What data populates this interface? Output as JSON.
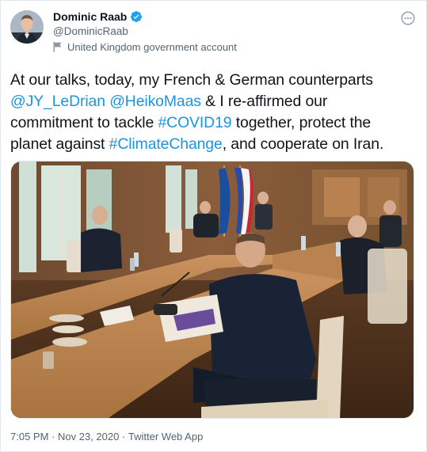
{
  "author": {
    "display_name": "Dominic Raab",
    "handle": "@DominicRaab",
    "label": "United Kingdom government account",
    "verified_icon": "verified-badge-icon",
    "label_icon": "flag-icon"
  },
  "tweet": {
    "lines": [
      [
        {
          "t": "At our talks, today, my French & German counterparts",
          "link": false
        }
      ],
      [
        {
          "t": "@JY_LeDrian",
          "link": true
        },
        {
          "t": " ",
          "link": false
        },
        {
          "t": "@HeikoMaas",
          "link": true
        },
        {
          "t": " & I re-affirmed our",
          "link": false
        }
      ],
      [
        {
          "t": "commitment to tackle ",
          "link": false
        },
        {
          "t": "#COVID19",
          "link": true
        },
        {
          "t": " together, protect the",
          "link": false
        }
      ],
      [
        {
          "t": "planet against ",
          "link": false
        },
        {
          "t": "#ClimateChange",
          "link": true
        },
        {
          "t": ", and cooperate on Iran.",
          "link": false
        }
      ]
    ],
    "media_placeholder": "Raab"
  },
  "meta": {
    "time": "7:05 PM",
    "separator1": " · ",
    "date": "Nov 23, 2020",
    "separator2": " · ",
    "source": "Twitter Web App"
  },
  "colors": {
    "link": "#1b95e0",
    "secondary": "#536471",
    "verified": "#1da1f2"
  }
}
